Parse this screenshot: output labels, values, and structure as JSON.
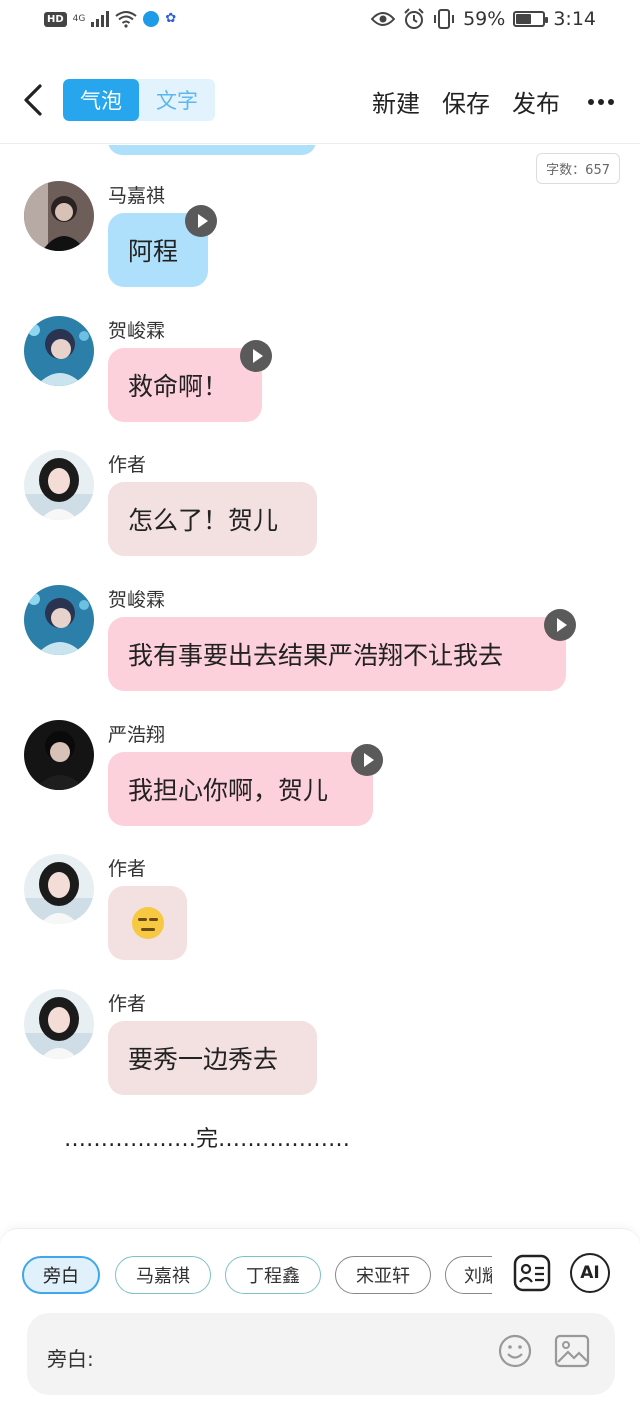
{
  "status_bar": {
    "hd": "HD",
    "network": "4G",
    "battery_text": "59%",
    "battery_level": 0.59,
    "time": "3:14"
  },
  "header": {
    "tabs": [
      {
        "label": "气泡",
        "active": true
      },
      {
        "label": "文字",
        "active": false
      }
    ],
    "actions": {
      "new": "新建",
      "save": "保存",
      "publish": "发布"
    }
  },
  "chat": {
    "word_count": "字数：657",
    "messages": [
      {
        "name": "马嘉祺",
        "text": "阿程",
        "style": "blue",
        "voice": true
      },
      {
        "name": "贺峻霖",
        "text": "救命啊！",
        "style": "pink",
        "voice": true
      },
      {
        "name": "作者",
        "text": "怎么了！贺儿",
        "style": "beige",
        "voice": false
      },
      {
        "name": "贺峻霖",
        "text": "我有事要出去结果严浩翔不让我去",
        "style": "pink",
        "voice": true
      },
      {
        "name": "严浩翔",
        "text": "我担心你啊，贺儿",
        "style": "pink",
        "voice": true
      },
      {
        "name": "作者",
        "text": "",
        "emoji": "expressionless-face",
        "style": "beige",
        "voice": false
      },
      {
        "name": "作者",
        "text": "要秀一边秀去",
        "style": "beige",
        "voice": false
      }
    ],
    "end_text": "………………完………………"
  },
  "bottom": {
    "chips": [
      {
        "label": "旁白",
        "active": true
      },
      {
        "label": "马嘉祺",
        "active": false
      },
      {
        "label": "丁程鑫",
        "active": false
      },
      {
        "label": "宋亚轩",
        "active": false
      },
      {
        "label": "刘耀文",
        "active": false
      }
    ],
    "ai_label": "AI",
    "input_label": "旁白:"
  },
  "colors": {
    "accent": "#27a6ee",
    "bubble_blue": "#aee0fb",
    "bubble_pink": "#fdd1dc",
    "bubble_beige": "#f3e0e0"
  },
  "icons": [
    "back-arrow-icon",
    "more-icon",
    "play-icon",
    "character-card-icon",
    "ai-icon",
    "smile-icon",
    "image-icon",
    "eye-icon",
    "alarm-icon",
    "vibrate-icon",
    "wifi-icon",
    "signal-icon",
    "battery-icon"
  ]
}
